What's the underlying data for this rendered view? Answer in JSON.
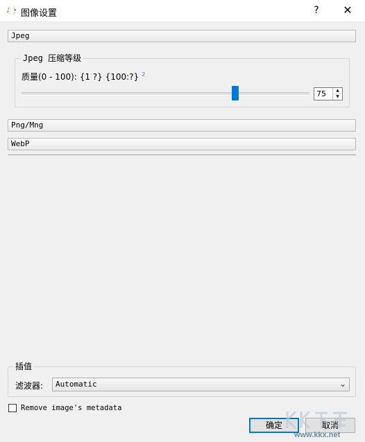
{
  "window": {
    "title": "图像设置",
    "help_label": "?",
    "close_label": "✕",
    "icon": "refresh-arrows-icon"
  },
  "sections": {
    "jpeg": "Jpeg",
    "png_mng": "Png/Mng",
    "webp": "WebP"
  },
  "jpeg_group": {
    "title": "Jpeg 压缩等级",
    "quality_label": "质量(0 - 100):  {1 ?} {100:?}",
    "quality_superscript": "2",
    "slider_value": 75,
    "slider_fraction": 0.75,
    "spin_value": "75",
    "accent": "#0078d7"
  },
  "interpolation": {
    "title": "插值",
    "filter_label": "滤波器:",
    "filter_value": "Automatic"
  },
  "metadata": {
    "checkbox_label": "Remove image's metadata",
    "checked": false
  },
  "buttons": {
    "ok": "确定",
    "cancel": "取消"
  },
  "watermark": {
    "text": "www.kkx.net"
  }
}
